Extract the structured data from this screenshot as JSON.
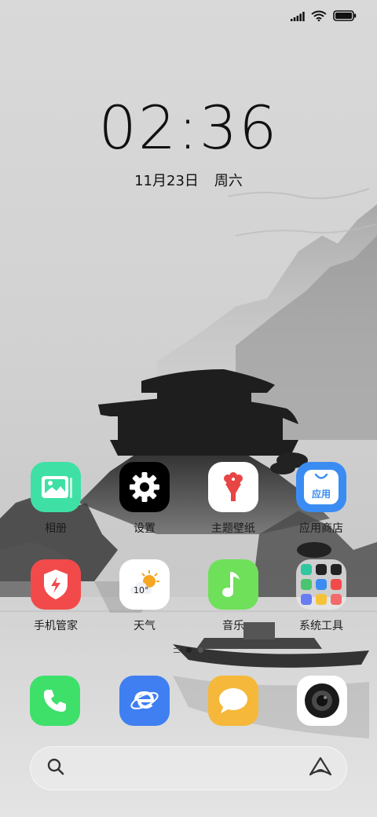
{
  "status_bar": {
    "signal_icon": "signal-bars-icon",
    "wifi_icon": "wifi-icon",
    "battery_icon": "battery-icon",
    "battery_level": 1.0
  },
  "lock": {
    "time": "02:36",
    "date": "11月23日",
    "weekday": "周六"
  },
  "apps": [
    {
      "label": "相册",
      "icon": "photos-icon",
      "color": "#3fe0a6"
    },
    {
      "label": "设置",
      "icon": "gear-icon",
      "color": "#000000"
    },
    {
      "label": "主题壁纸",
      "icon": "theme-flower-icon",
      "color": "#ffffff"
    },
    {
      "label": "应用商店",
      "icon": "app-store-bag-icon",
      "color": "#3b8cf2",
      "badge_text": "应用"
    },
    {
      "label": "手机管家",
      "icon": "shield-bolt-icon",
      "color": "#f24a4a"
    },
    {
      "label": "天气",
      "icon": "weather-sun-cloud-icon",
      "color": "#ffffff",
      "badge_text": "10°"
    },
    {
      "label": "音乐",
      "icon": "music-note-icon",
      "color": "#6fe05a"
    },
    {
      "label": "系统工具",
      "icon": "folder-icon",
      "color": "#e8e8e8"
    }
  ],
  "page_indicator": {
    "pages": 2,
    "current": 1
  },
  "dock": [
    {
      "name": "phone",
      "icon": "phone-icon",
      "color": "#3ee06a"
    },
    {
      "name": "browser",
      "icon": "browser-e-icon",
      "color": "#3f7ff2"
    },
    {
      "name": "messages",
      "icon": "message-bubble-icon",
      "color": "#f5b83a"
    },
    {
      "name": "camera",
      "icon": "camera-icon",
      "color": "#ffffff"
    }
  ],
  "search": {
    "search_icon": "search-icon",
    "assistant_icon": "assistant-logo-icon"
  }
}
